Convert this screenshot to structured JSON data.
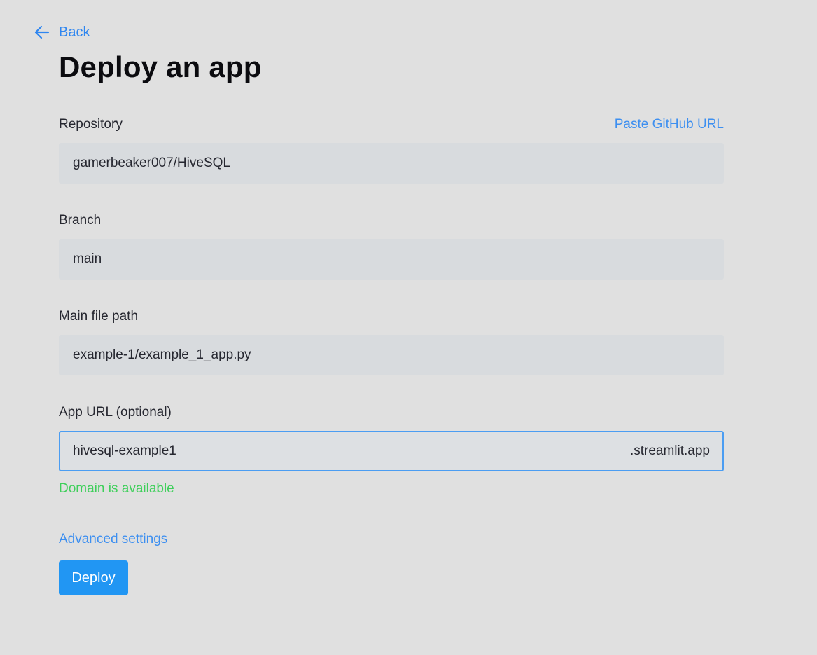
{
  "nav": {
    "back_label": "Back",
    "back_icon": "arrow-left-icon"
  },
  "page": {
    "title": "Deploy an app"
  },
  "form": {
    "repository": {
      "label": "Repository",
      "action_link": "Paste GitHub URL",
      "value": "gamerbeaker007/HiveSQL"
    },
    "branch": {
      "label": "Branch",
      "value": "main"
    },
    "main_file": {
      "label": "Main file path",
      "value": "example-1/example_1_app.py"
    },
    "app_url": {
      "label": "App URL (optional)",
      "value": "hivesql-example1",
      "suffix": ".streamlit.app",
      "status": "Domain is available"
    },
    "advanced_settings": "Advanced settings",
    "deploy_label": "Deploy"
  },
  "colors": {
    "background": "#e0e0e0",
    "accent": "#2196f3",
    "link": "#3d8ff0",
    "success": "#3ecf5a",
    "input_bg": "#d8dbde"
  }
}
